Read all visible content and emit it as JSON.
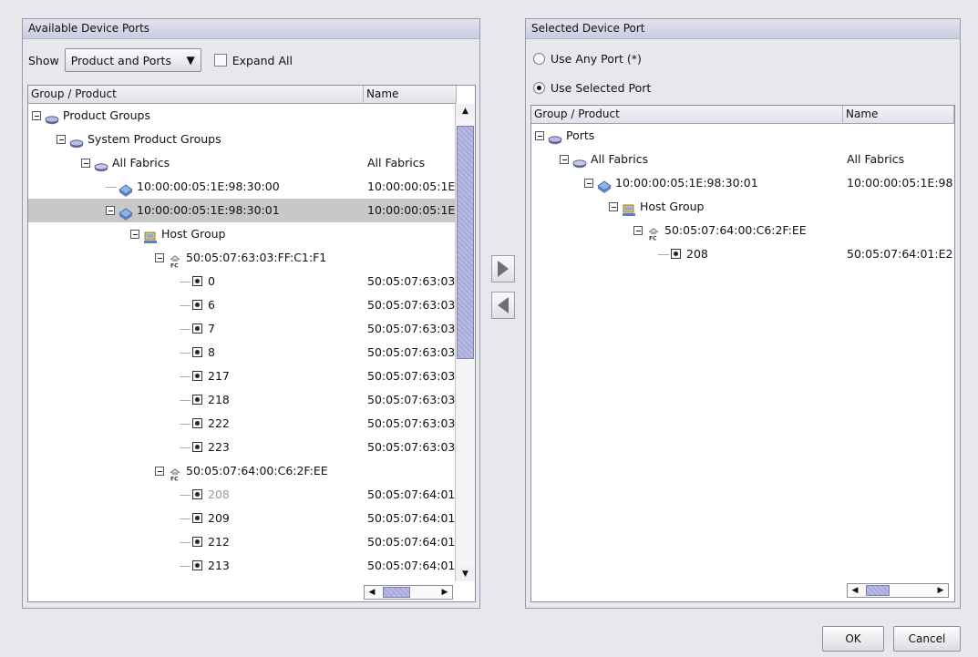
{
  "left_panel": {
    "title": "Available Device Ports",
    "show_label": "Show",
    "show_value": "Product and Ports",
    "expand_all": "Expand All",
    "columns": [
      "Group / Product",
      "Name"
    ],
    "rows": [
      {
        "label": "Product Groups",
        "name": "",
        "icon": "product-group-icon"
      },
      {
        "label": "System Product Groups",
        "name": "",
        "icon": "product-group-icon"
      },
      {
        "label": "All Fabrics",
        "name": "All Fabrics",
        "icon": "fabric-icon"
      },
      {
        "label": "10:00:00:05:1E:98:30:00",
        "name": "10:00:00:05:1E",
        "icon": "switch-icon"
      },
      {
        "label": "10:00:00:05:1E:98:30:01",
        "name": "10:00:00:05:1E",
        "icon": "switch-icon"
      },
      {
        "label": "Host Group",
        "name": "",
        "icon": "host-group-icon"
      },
      {
        "label": "50:05:07:63:03:FF:C1:F1",
        "name": "",
        "icon": "fc-device-icon"
      },
      {
        "label": "0",
        "name": "50:05:07:63:03",
        "icon": "port-icon"
      },
      {
        "label": "6",
        "name": "50:05:07:63:03",
        "icon": "port-icon"
      },
      {
        "label": "7",
        "name": "50:05:07:63:03",
        "icon": "port-icon"
      },
      {
        "label": "8",
        "name": "50:05:07:63:03",
        "icon": "port-icon"
      },
      {
        "label": "217",
        "name": "50:05:07:63:03",
        "icon": "port-icon"
      },
      {
        "label": "218",
        "name": "50:05:07:63:03",
        "icon": "port-icon"
      },
      {
        "label": "222",
        "name": "50:05:07:63:03",
        "icon": "port-icon"
      },
      {
        "label": "223",
        "name": "50:05:07:63:03",
        "icon": "port-icon"
      },
      {
        "label": "50:05:07:64:00:C6:2F:EE",
        "name": "",
        "icon": "fc-device-icon"
      },
      {
        "label": "208",
        "name": "50:05:07:64:01",
        "icon": "port-icon"
      },
      {
        "label": "209",
        "name": "50:05:07:64:01",
        "icon": "port-icon"
      },
      {
        "label": "212",
        "name": "50:05:07:64:01",
        "icon": "port-icon"
      },
      {
        "label": "213",
        "name": "50:05:07:64:01",
        "icon": "port-icon"
      }
    ]
  },
  "right_panel": {
    "title": "Selected Device Port",
    "radio_any": "Use Any Port (*)",
    "radio_selected": "Use Selected Port",
    "selected_option": "Use Selected Port",
    "columns": [
      "Group / Product",
      "Name"
    ],
    "rows": [
      {
        "label": "Ports",
        "name": "",
        "icon": "product-group-icon"
      },
      {
        "label": "All Fabrics",
        "name": "All Fabrics",
        "icon": "fabric-icon"
      },
      {
        "label": "10:00:00:05:1E:98:30:01",
        "name": "10:00:00:05:1E:98",
        "icon": "switch-icon"
      },
      {
        "label": "Host Group",
        "name": "",
        "icon": "host-group-icon"
      },
      {
        "label": "50:05:07:64:00:C6:2F:EE",
        "name": "",
        "icon": "fc-device-icon"
      },
      {
        "label": "208",
        "name": "50:05:07:64:01:E2",
        "icon": "port-icon"
      }
    ]
  },
  "transfer": {
    "add_icon": "arrow-right-icon",
    "remove_icon": "arrow-left-icon"
  },
  "buttons": {
    "ok": "OK",
    "cancel": "Cancel"
  },
  "colors": {
    "selection": "#c8c8c8",
    "scroll_thumb": "#a6a9d8",
    "title_bar": "#c9cce0"
  }
}
